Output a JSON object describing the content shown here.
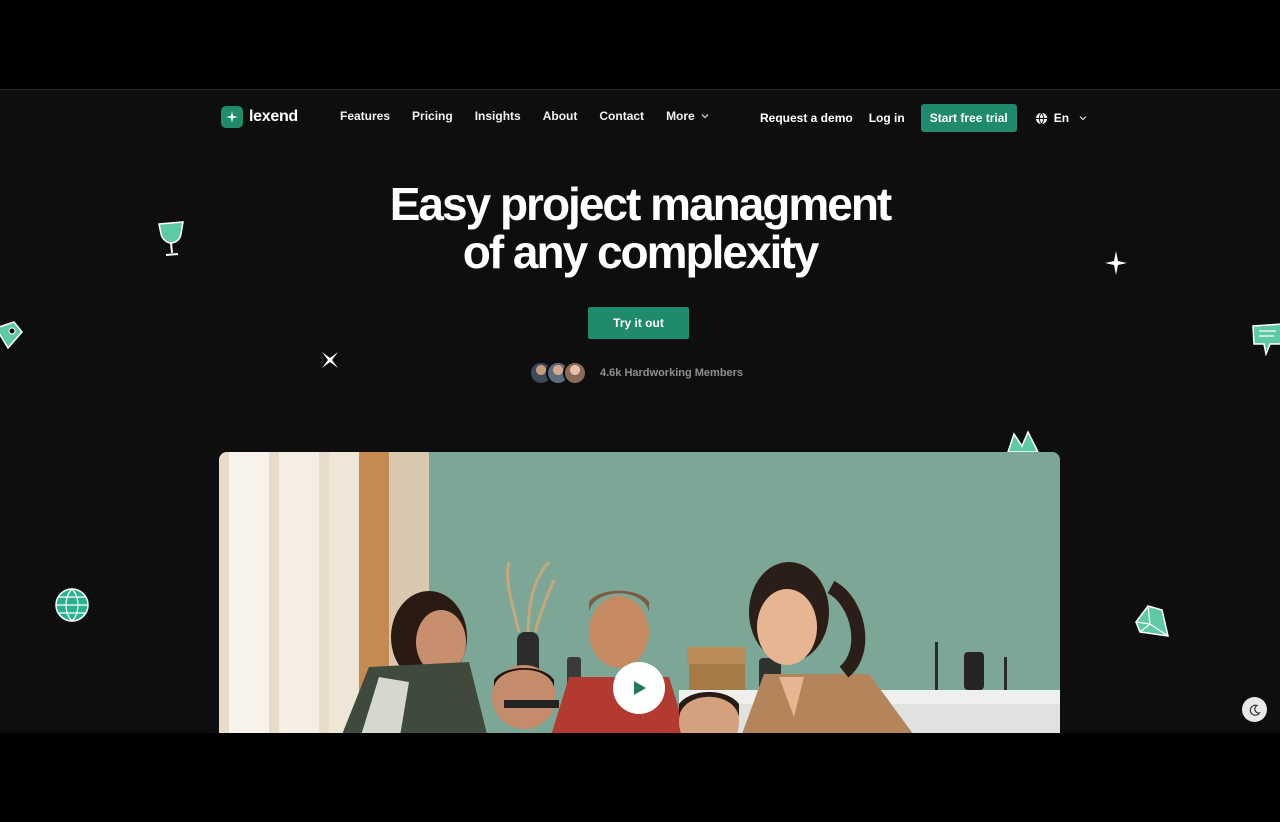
{
  "brand": {
    "name": "lexend",
    "accent": "#1f8a6c"
  },
  "nav": {
    "links": [
      "Features",
      "Pricing",
      "Insights",
      "About",
      "Contact"
    ],
    "more_label": "More",
    "request_demo": "Request a demo",
    "login": "Log in",
    "start_trial": "Start free trial",
    "language": "En"
  },
  "hero": {
    "title_line1": "Easy project managment",
    "title_line2": "of any complexity",
    "cta": "Try it out",
    "members_text": "4.6k Hardworking Members"
  },
  "icons": [
    "globe-icon",
    "chevron-down-icon",
    "play-icon",
    "moon-icon",
    "trophy-icon",
    "sparkle-icon",
    "gem-icon",
    "chat-bubble-icon"
  ]
}
